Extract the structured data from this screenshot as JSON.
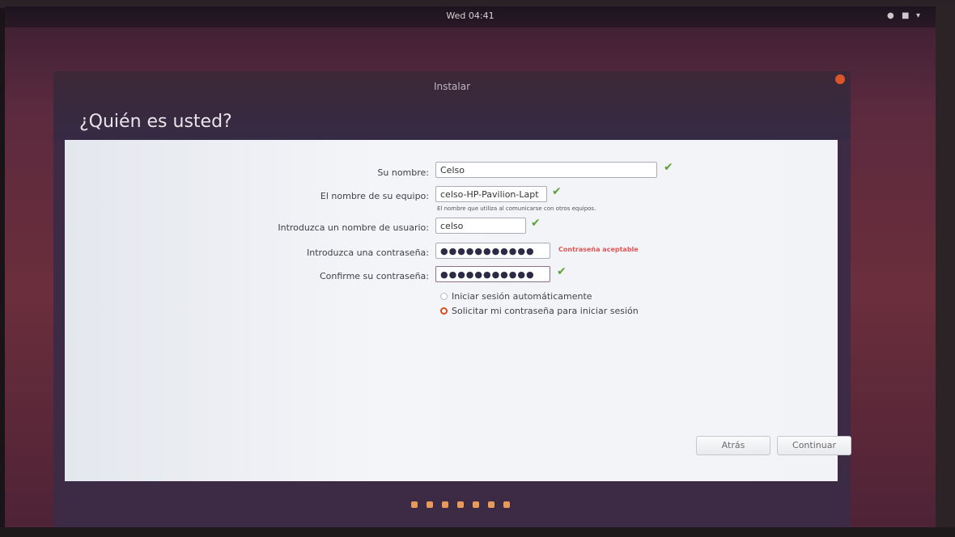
{
  "topbar": {
    "clock": "Wed 04:41",
    "tray_icons": [
      "network-icon",
      "volume-icon",
      "power-icon"
    ]
  },
  "window": {
    "title": "Instalar",
    "heading": "¿Quién es usted?"
  },
  "form": {
    "name_label": "Su nombre:",
    "name_value": "Celso",
    "computer_label": "El nombre de su equipo:",
    "computer_value": "celso-HP-Pavilion-Lapt",
    "computer_hint": "El nombre que utiliza al comunicarse con otros equipos.",
    "username_label": "Introduzca un nombre de usuario:",
    "username_value": "celso",
    "password_label": "Introduzca una contraseña:",
    "password_value": "●●●●●●●●●●●",
    "password_strength": "Contraseña aceptable",
    "confirm_label": "Confirme su contraseña:",
    "confirm_value": "●●●●●●●●●●●",
    "radio_auto_login": "Iniciar sesión automáticamente",
    "radio_require_password": "Solicitar mi contraseña para iniciar sesión",
    "selected_radio": "require_password"
  },
  "buttons": {
    "back": "Atrás",
    "continue": "Continuar"
  },
  "progress": {
    "total_steps": 7
  },
  "colors": {
    "accent": "#de4a1a",
    "check": "#5fa13b",
    "strength_text": "#e05656"
  }
}
